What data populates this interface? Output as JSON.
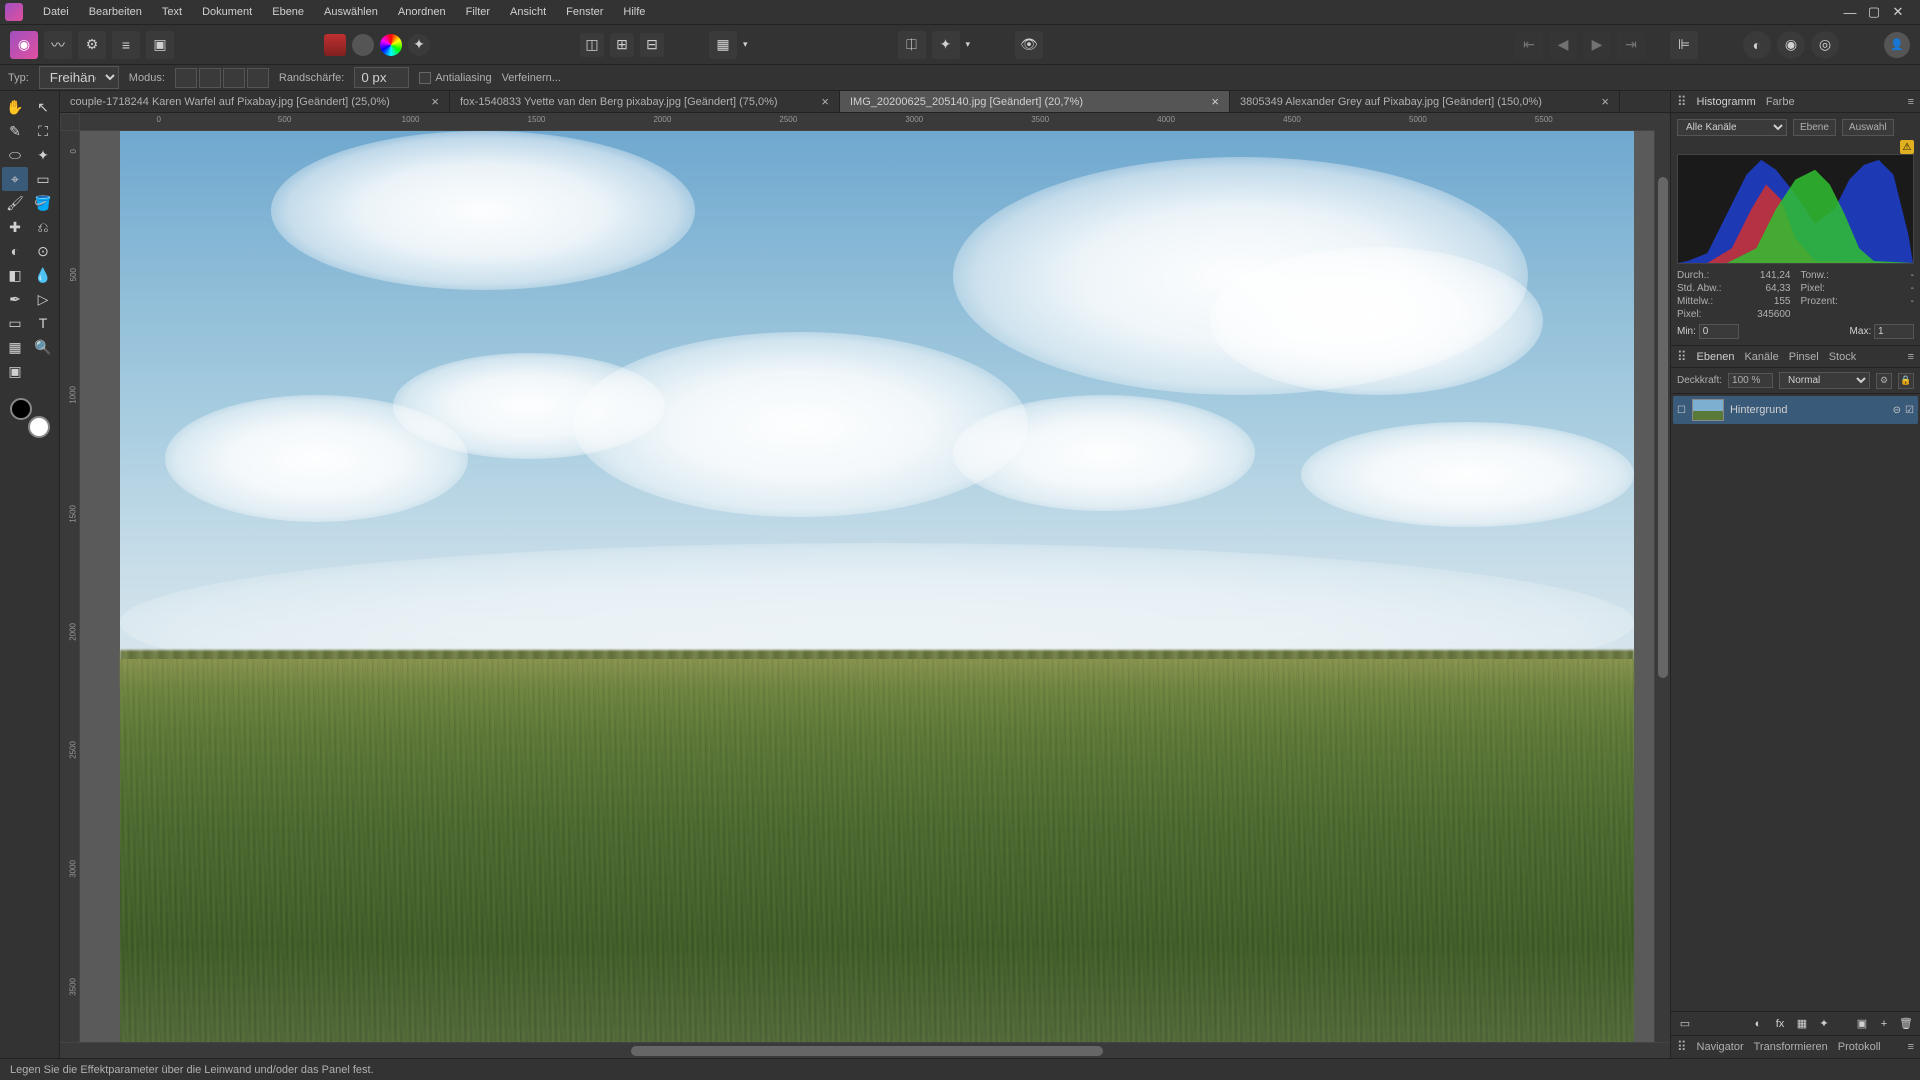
{
  "menu": [
    "Datei",
    "Bearbeiten",
    "Text",
    "Dokument",
    "Ebene",
    "Auswählen",
    "Anordnen",
    "Filter",
    "Ansicht",
    "Fenster",
    "Hilfe"
  ],
  "context": {
    "typ_label": "Typ:",
    "typ_value": "Freihändig",
    "modus_label": "Modus:",
    "feather_label": "Randschärfe:",
    "feather_value": "0 px",
    "antialias": "Antialiasing",
    "refine": "Verfeinern..."
  },
  "tabs": [
    {
      "title": "couple-1718244 Karen Warfel auf Pixabay.jpg [Geändert] (25,0%)",
      "active": false
    },
    {
      "title": "fox-1540833 Yvette van den Berg pixabay.jpg [Geändert] (75,0%)",
      "active": false
    },
    {
      "title": "IMG_20200625_205140.jpg [Geändert] (20,7%)",
      "active": true
    },
    {
      "title": "3805349 Alexander Grey auf Pixabay.jpg [Geändert] (150,0%)",
      "active": false
    }
  ],
  "ruler_h": [
    "0",
    "500",
    "1000",
    "1500",
    "2000",
    "2500",
    "3000",
    "3500",
    "4000",
    "4500",
    "5000",
    "5500"
  ],
  "ruler_v": [
    "0",
    "500",
    "1000",
    "1500",
    "2000",
    "2500",
    "3000",
    "3500"
  ],
  "histogram_panel": {
    "tab_histo": "Histogramm",
    "tab_color": "Farbe",
    "channels_label": "Alle Kanäle",
    "btn_ebene": "Ebene",
    "btn_auswahl": "Auswahl"
  },
  "stats": {
    "durch_l": "Durch.:",
    "durch_v": "141,24",
    "tonw_l": "Tonw.:",
    "tonw_v": "-",
    "std_l": "Std. Abw.:",
    "std_v": "64,33",
    "pixel2_l": "Pixel:",
    "pixel2_v": "-",
    "mittel_l": "Mittelw.:",
    "mittel_v": "155",
    "proz_l": "Prozent:",
    "proz_v": "-",
    "pixel_l": "Pixel:",
    "pixel_v": "345600",
    "min_l": "Min:",
    "min_v": "0",
    "max_l": "Max:",
    "max_v": "1"
  },
  "layers_panel": {
    "tab_ebenen": "Ebenen",
    "tab_kanale": "Kanäle",
    "tab_pinsel": "Pinsel",
    "tab_stock": "Stock",
    "opacity_label": "Deckkraft:",
    "opacity_value": "100 %",
    "blend_value": "Normal",
    "layer0": "Hintergrund"
  },
  "nav_panel": {
    "tab_nav": "Navigator",
    "tab_trans": "Transformieren",
    "tab_proto": "Protokoll"
  },
  "status": "Legen Sie die Effektparameter über die Leinwand und/oder das Panel fest."
}
